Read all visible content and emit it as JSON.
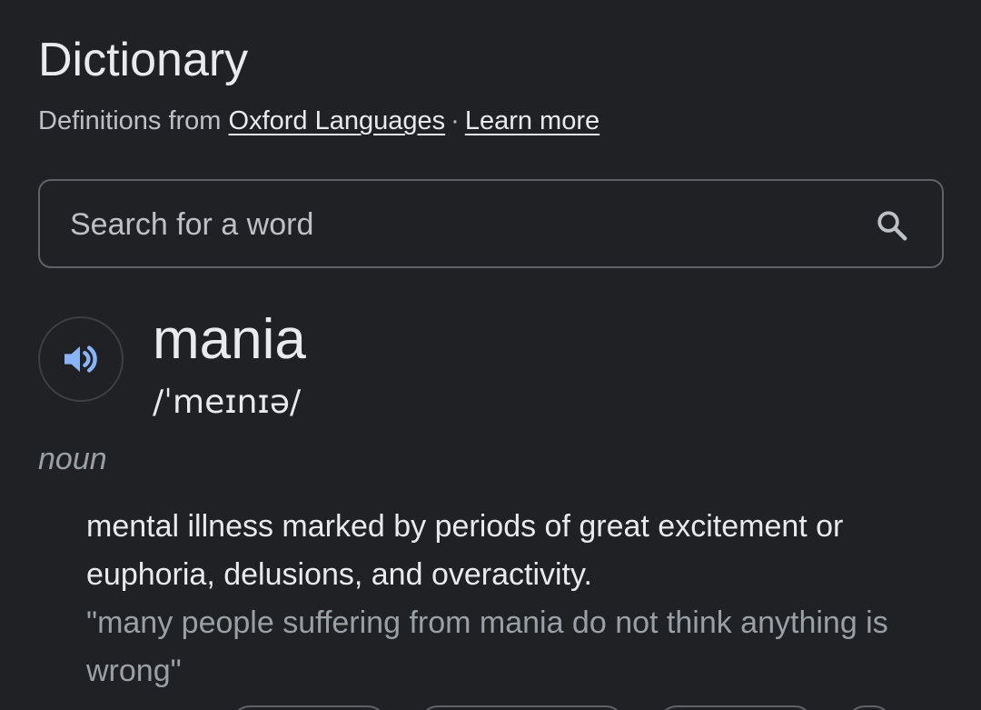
{
  "header": {
    "title": "Dictionary",
    "source_prefix": "Definitions from",
    "source_link": "Oxford Languages",
    "separator": "·",
    "learn_more": "Learn more"
  },
  "search": {
    "placeholder": "Search for a word",
    "icon": "search-icon"
  },
  "entry": {
    "speaker_icon": "speaker-icon",
    "word": "mania",
    "phonetic": "/ˈmeɪnɪə/",
    "part_of_speech": "noun",
    "definition": "mental illness marked by periods of great excitement or euphoria, delusions, and overactivity.",
    "example": "\"many people suffering from mania do not think anything is wrong\""
  },
  "colors": {
    "background": "#202124",
    "text_primary": "#e8eaed",
    "text_secondary": "#9aa0a6",
    "accent_icon": "#8ab4f8",
    "border": "#5f6368"
  }
}
